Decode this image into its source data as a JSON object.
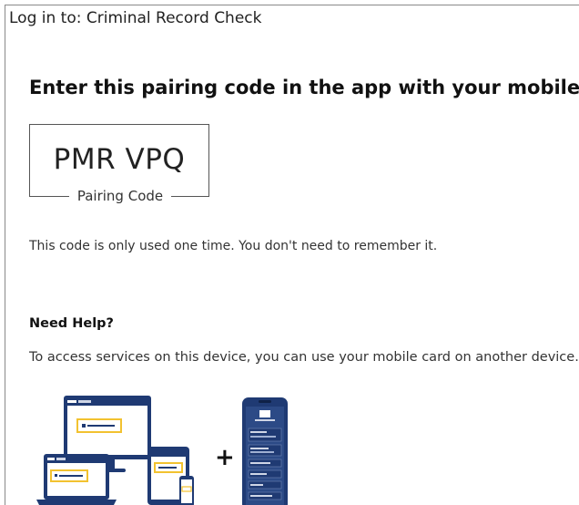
{
  "window": {
    "title": "Log in to: Criminal Record Check"
  },
  "main": {
    "headline": "Enter this pairing code in the app with your mobile card",
    "pairing": {
      "code": "PMR VPQ",
      "label": "Pairing Code"
    },
    "info": "This code is only used one time. You don't need to remember it.",
    "help": {
      "heading": "Need Help?",
      "text": "To access services on this device, you can use your mobile card on another device."
    },
    "illustration": {
      "plus": "+"
    }
  },
  "colors": {
    "device_navy": "#1f3a73",
    "highlight_yellow": "#f2c230",
    "border": "#555555"
  }
}
